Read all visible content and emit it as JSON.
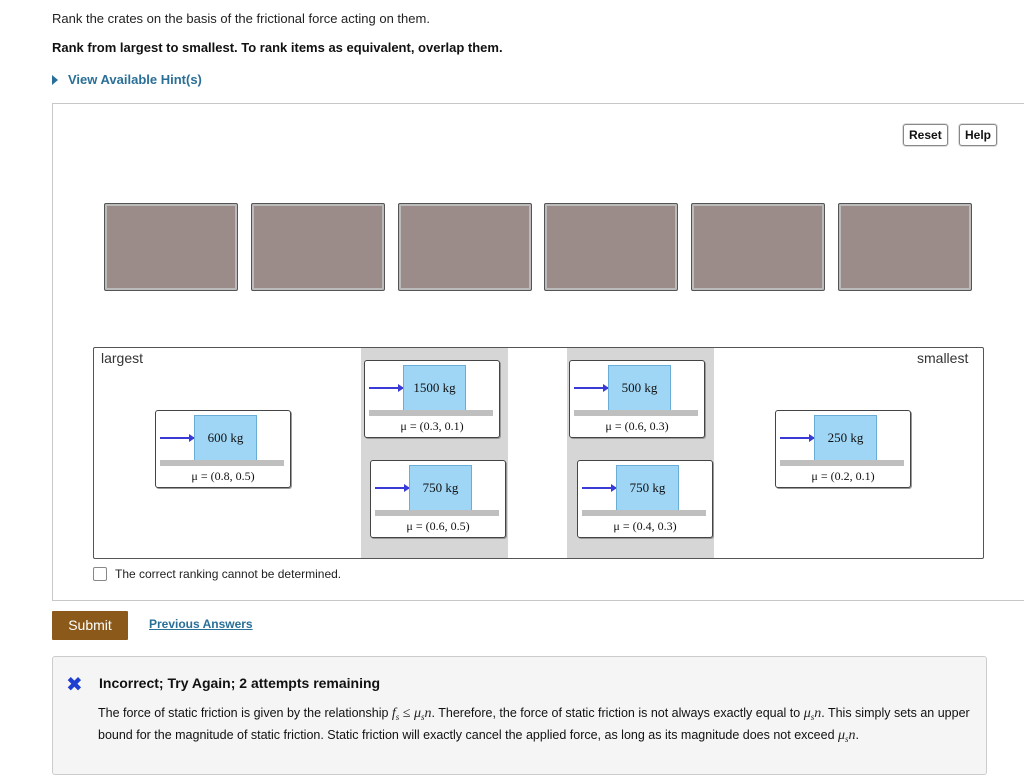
{
  "question": {
    "line1": "Rank the crates on the basis of the frictional force acting on them.",
    "line2": "Rank from largest to smallest. To rank items as equivalent, overlap them."
  },
  "hint": {
    "label": "View Available Hint(s)"
  },
  "toolbar": {
    "reset_label": "Reset",
    "help_label": "Help"
  },
  "ranking": {
    "largest_label": "largest",
    "smallest_label": "smallest",
    "cards": [
      {
        "mass": "600 kg",
        "mu": "μ = (0.8, 0.5)"
      },
      {
        "mass": "1500 kg",
        "mu": "μ = (0.3, 0.1)"
      },
      {
        "mass": "750 kg",
        "mu": "μ = (0.6, 0.5)"
      },
      {
        "mass": "500 kg",
        "mu": "μ = (0.6, 0.3)"
      },
      {
        "mass": "750 kg",
        "mu": "μ = (0.4, 0.3)"
      },
      {
        "mass": "250 kg",
        "mu": "μ = (0.2, 0.1)"
      }
    ]
  },
  "cannot_determine_label": "The correct ranking cannot be determined.",
  "submit_label": "Submit",
  "previous_answers_label": "Previous Answers",
  "feedback": {
    "icon": "x-icon",
    "title": "Incorrect; Try Again; 2 attempts remaining",
    "text_part1": "The force of static friction is given by the relationship ",
    "text_part2": ". Therefore, the force of static friction is not always exactly equal to ",
    "text_part3": ". This simply sets an upper bound for the magnitude of static friction. Static friction will exactly cancel the applied force, as long as its magnitude does not exceed ",
    "text_part4": "."
  },
  "colors": {
    "accent": "#2a6f97",
    "submit": "#8b5a1b",
    "crate": "#9fd6f5",
    "slot": "#9b8b89",
    "error_icon": "#1f3fd1"
  }
}
